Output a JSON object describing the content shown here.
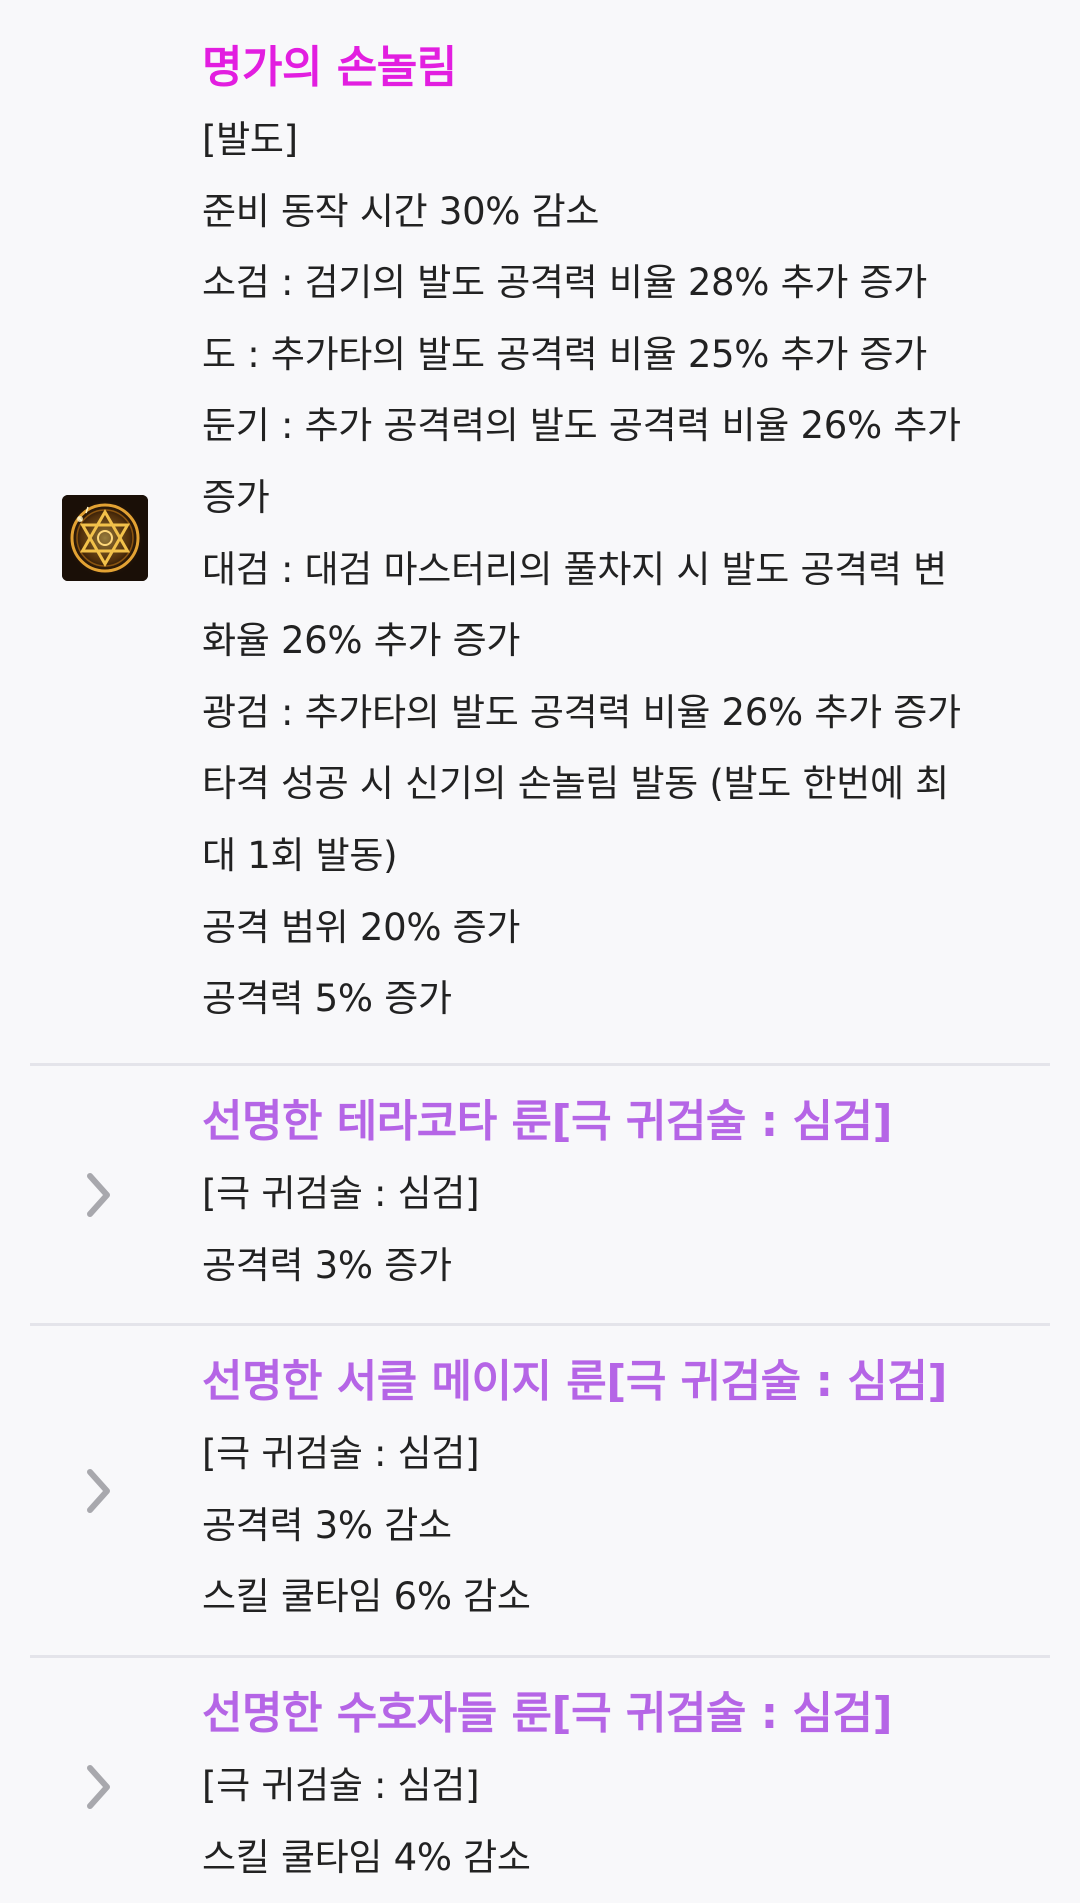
{
  "colors": {
    "legendary_title": "#e21ee0",
    "rune_title": "#b565e6",
    "text": "#222222",
    "divider": "#e4e4ea",
    "chevron": "#a8a8ad"
  },
  "legendary": {
    "icon": "hexagram-rune-icon",
    "title": "명가의 손놀림",
    "lines": [
      "[발도]",
      "준비 동작 시간 30% 감소",
      "소검 : 검기의 발도 공격력 비율 28% 추가 증가",
      "도 : 추가타의 발도 공격력 비율 25% 추가 증가",
      "둔기 : 추가 공격력의 발도 공격력 비율 26% 추가",
      "증가",
      "대검 : 대검 마스터리의 풀차지 시 발도 공격력 변",
      "화율 26% 추가 증가",
      "광검 : 추가타의 발도 공격력 비율 26% 추가 증가",
      "타격 성공 시 신기의 손놀림 발동 (발도 한번에 최",
      "대 1회 발동)",
      "공격 범위 20% 증가",
      "공격력 5% 증가"
    ]
  },
  "runes": [
    {
      "icon": "chevron-right-icon",
      "title": "선명한 테라코타 룬[극 귀검술 : 심검]",
      "lines": [
        "[극 귀검술 : 심검]",
        "공격력 3% 증가"
      ]
    },
    {
      "icon": "chevron-right-icon",
      "title": "선명한 서클 메이지 룬[극 귀검술 : 심검]",
      "lines": [
        "[극 귀검술 : 심검]",
        "공격력 3% 감소",
        "스킬 쿨타임 6% 감소"
      ]
    },
    {
      "icon": "chevron-right-icon",
      "title": "선명한 수호자들 룬[극 귀검술 : 심검]",
      "lines": [
        "[극 귀검술 : 심검]",
        "스킬 쿨타임 4% 감소"
      ]
    }
  ]
}
